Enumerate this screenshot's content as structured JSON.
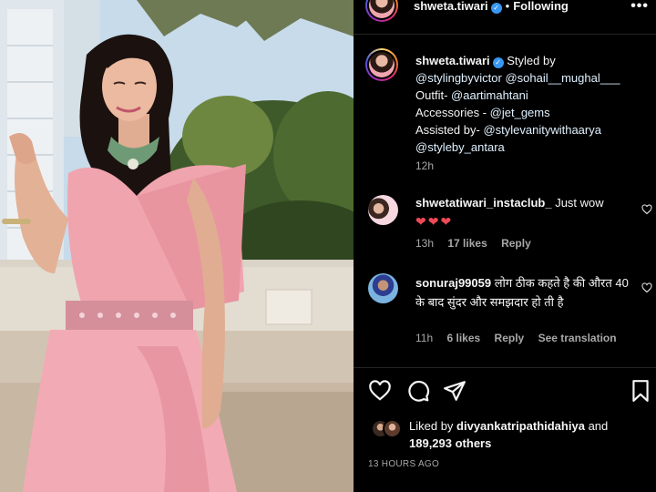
{
  "post": {
    "username": "shweta.tiwari",
    "verified_glyph": "✓",
    "separator": "•",
    "follow_status": "Following",
    "more_icon": "more-icon"
  },
  "caption": {
    "username": "shweta.tiwari",
    "text_parts": {
      "styled_by": "Styled by",
      "m1": "@stylingbyvictor",
      "m2": "@sohail__mughal___",
      "outfit": "Outfit-",
      "m3": "@aartimahtani",
      "accessories": "Accessories -",
      "m4": "@jet_gems",
      "assisted": "Assisted by-",
      "m5": "@stylevanitywithaarya",
      "m6": "@styleby_antara"
    },
    "time": "12h"
  },
  "comments": [
    {
      "username": "shwetatiwari_instaclub_",
      "text": "Just wow",
      "hearts": "❤❤❤",
      "time": "13h",
      "likes": "17 likes",
      "reply": "Reply"
    },
    {
      "username": "sonuraj99059",
      "text": "लोग ठीक कहते है की औरत 40 के बाद सुंदर और समझदार हो ती है",
      "time": "11h",
      "likes": "6 likes",
      "reply": "Reply",
      "translate": "See translation"
    }
  ],
  "likes": {
    "prefix": "Liked by",
    "user": "divyankatripathidahiya",
    "conj": "and",
    "others": "189,293 others"
  },
  "post_age": "13 HOURS AGO",
  "icons": {
    "like": "heart-icon",
    "comment": "comment-icon",
    "share": "share-icon",
    "save": "bookmark-icon"
  },
  "colors": {
    "background": "#000000",
    "text": "#f5f5f5",
    "secondary": "#a8a8a8",
    "verified": "#3897f0",
    "heart": "#ed4956",
    "saree": "#f0a4ae"
  }
}
